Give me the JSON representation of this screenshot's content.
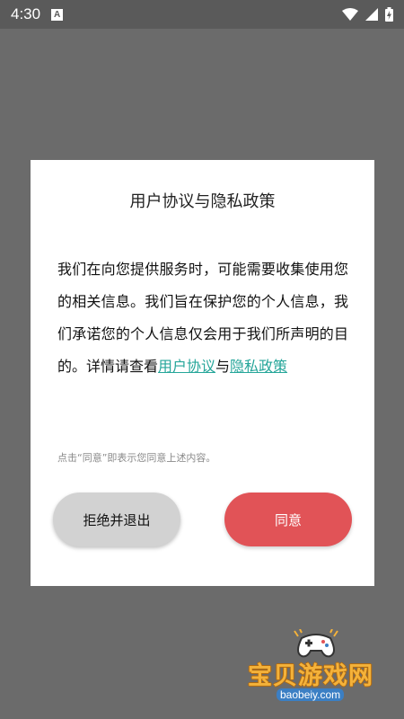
{
  "status_bar": {
    "time": "4:30",
    "app_icon_glyph": "A",
    "icons": [
      "wifi-icon",
      "cell-signal-icon",
      "battery-charging-icon"
    ]
  },
  "dialog": {
    "title": "用户协议与隐私政策",
    "body_text": "我们在向您提供服务时，可能需要收集使用您的相关信息。我们旨在保护您的个人信息，我们承诺您的个人信息仅会用于我们所声明的目的。详情请查看",
    "link_user_agreement": "用户协议",
    "conjunction": "与",
    "link_privacy_policy": "隐私政策",
    "note": "点击“同意”即表示您同意上述内容。",
    "decline_label": "拒绝并退出",
    "agree_label": "同意"
  },
  "watermark": {
    "title": "宝贝游戏网",
    "url": "baobeiy.com",
    "icon": "gamepad-icon"
  },
  "colors": {
    "overlay": "#6b6b6b",
    "agree_button": "#e15357",
    "decline_button": "#d2d2d2",
    "link": "#26a69a"
  }
}
